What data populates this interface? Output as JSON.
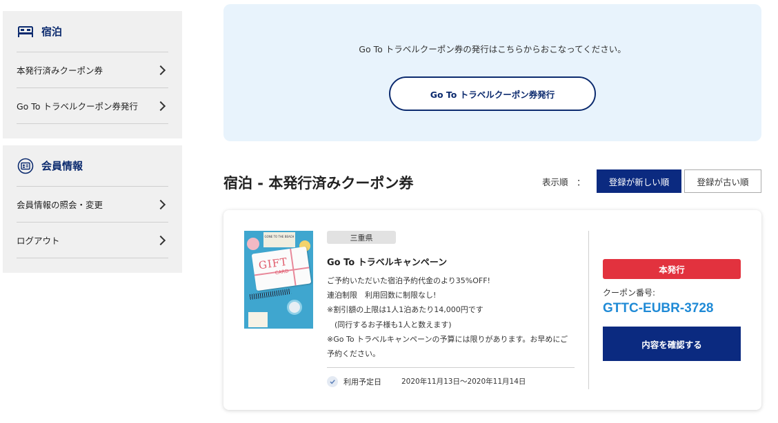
{
  "sidebar": {
    "stay": {
      "title": "宿泊",
      "icon": "bed-icon",
      "items": [
        {
          "label": "本発行済みクーポン券"
        },
        {
          "label": "Go To トラベルクーポン券発行"
        }
      ]
    },
    "member": {
      "title": "会員情報",
      "icon": "member-card-icon",
      "items": [
        {
          "label": "会員情報の照会・変更"
        },
        {
          "label": "ログアウト"
        }
      ]
    }
  },
  "issue_box": {
    "text": "Go To トラベルクーポン券の発行はこちらからおこなってください。",
    "button_label": "Go To トラベルクーポン券発行"
  },
  "section": {
    "title": "宿泊 - 本発行済みクーポン券",
    "sort_label": "表示順　：",
    "sort_new": "登録が新しい順",
    "sort_old": "登録が古い順"
  },
  "coupon": {
    "image": {
      "gift_word": "GIFT",
      "card_word": "CARD",
      "beach_text": "GONE TO THE BEACH"
    },
    "prefecture": "三重県",
    "campaign_name": "Go To トラベルキャンペーン",
    "description": [
      "ご予約いただいた宿泊予約代金のより35%OFF!",
      "連泊制限　利用回数に制限なし!",
      "※割引額の上限は1人1泊あたり14,000円です",
      "　(同行するお子様も1人と数えます)",
      "※Go To トラベルキャンペーンの予算には限りがあります。お早めにご",
      "予約ください。"
    ],
    "use_label": "利用予定日",
    "use_value": "2020年11月13日〜2020年11月14日",
    "status": "本発行",
    "coupon_label": "クーポン番号:",
    "coupon_number": "GTTC-EUBR-3728",
    "confirm_button": "内容を確認する"
  },
  "colors": {
    "navy": "#0b2a80",
    "accent_blue": "#1f8ad6",
    "status_red": "#e2323e",
    "issue_bg": "#e8f3fc"
  }
}
